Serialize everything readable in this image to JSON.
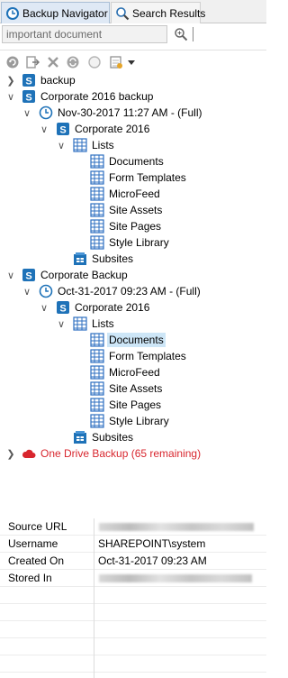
{
  "tabs": [
    {
      "label": "Backup Navigator",
      "close": "✕"
    },
    {
      "label": "Search Results"
    }
  ],
  "search": {
    "value": "important document"
  },
  "tree": {
    "backup": "backup",
    "corporate2016backup": {
      "label": "Corporate 2016 backup",
      "snapshot": "Nov-30-2017 11:27 AM - (Full)",
      "site": "Corporate 2016",
      "lists": "Lists",
      "items": [
        "Documents",
        "Form Templates",
        "MicroFeed",
        "Site Assets",
        "Site Pages",
        "Style Library"
      ],
      "subsites": "Subsites"
    },
    "corporatebackup": {
      "label": "Corporate Backup",
      "snapshot": "Oct-31-2017 09:23 AM - (Full)",
      "site": "Corporate 2016",
      "lists": "Lists",
      "items": [
        "Documents",
        "Form Templates",
        "MicroFeed",
        "Site Assets",
        "Site Pages",
        "Style Library"
      ],
      "subsites": "Subsites"
    },
    "onedrive": "One Drive Backup (65 remaining)"
  },
  "properties": {
    "rows": [
      {
        "name": "Source URL",
        "value": ""
      },
      {
        "name": "Username",
        "value": "SHAREPOINT\\system"
      },
      {
        "name": "Created On",
        "value": "Oct-31-2017 09:23 AM"
      },
      {
        "name": "Stored In",
        "value": ""
      }
    ]
  },
  "colors": {
    "accent": "#1e72b8",
    "selection": "#cde6f7",
    "warning": "#d8262e"
  }
}
